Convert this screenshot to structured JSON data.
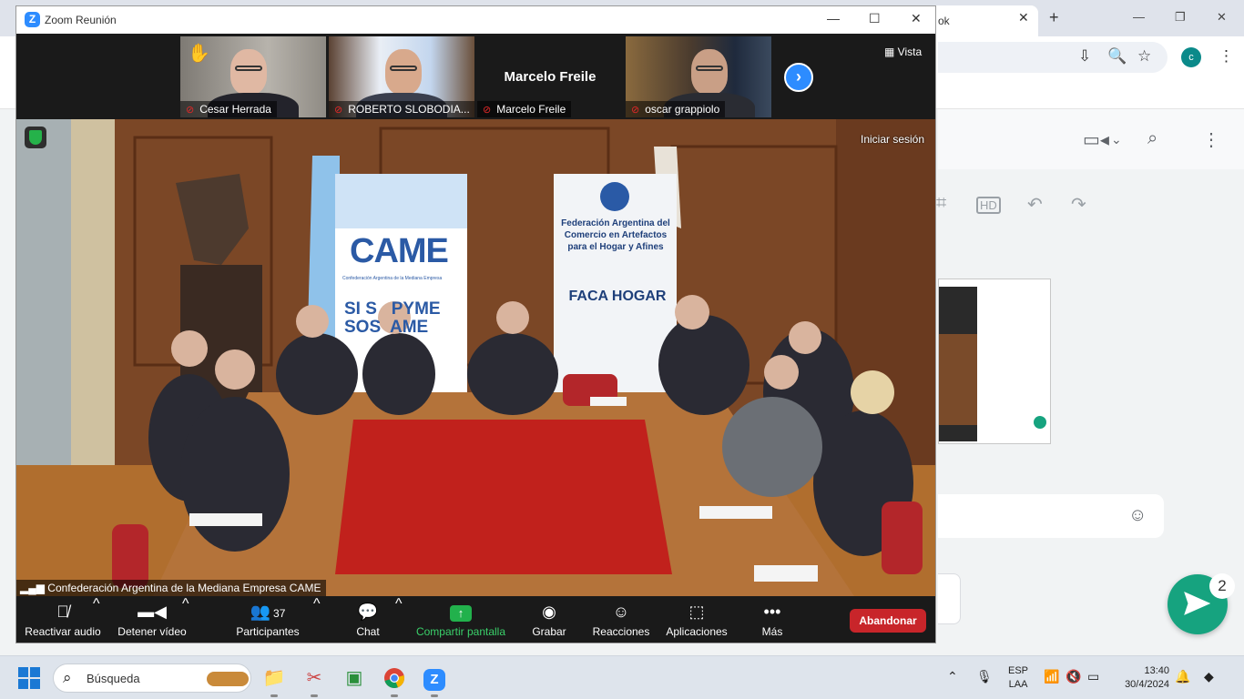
{
  "browser": {
    "tab_label": "ok",
    "tab_close": "✕",
    "new_tab": "+",
    "profile_initial": "c",
    "send_badge": "2"
  },
  "zoom": {
    "window_title": "Zoom Reunión",
    "logo_letter": "Z",
    "participants": [
      {
        "name": "Cesar Herrada",
        "muted": true,
        "hand_raised": true
      },
      {
        "name": "ROBERTO SLOBODIA...",
        "muted": true
      },
      {
        "name": "Marcelo Freile",
        "muted": true,
        "display_name": "Marcelo Freile",
        "video_off": true
      },
      {
        "name": "oscar grappiolo",
        "muted": true
      }
    ],
    "next_arrow": "›",
    "view_label": "Vista",
    "sign_in": "Iniciar sesión",
    "meeting_name": "Confederación Argentina de la Mediana Empresa CAME",
    "controls": {
      "audio": "Reactivar audio",
      "video": "Detener vídeo",
      "participants": "Participantes",
      "participants_count": "37",
      "chat": "Chat",
      "share": "Compartir pantalla",
      "record": "Grabar",
      "reactions": "Reacciones",
      "apps": "Aplicaciones",
      "more": "Más",
      "leave": "Abandonar"
    },
    "scene": {
      "banner_left_brand": "CAME",
      "banner_left_tagline": "Confederación Argentina de la Mediana Empresa",
      "banner_left_slogan_1": "SI S   PYME",
      "banner_left_slogan_2": "SOS  AME",
      "banner_right_title": "Federación Argentina del Comercio en Artefactos para el Hogar y Afines",
      "banner_right_brand": "FACA HOGAR"
    }
  },
  "taskbar": {
    "search_placeholder": "Búsqueda",
    "language_1": "ESP",
    "language_2": "LAA",
    "time": "13:40",
    "date": "30/4/2024"
  },
  "colors": {
    "zoom_blue": "#2d8cff",
    "leave_red": "#c8252a",
    "share_green": "#22b14c",
    "send_green": "#16a37f"
  }
}
